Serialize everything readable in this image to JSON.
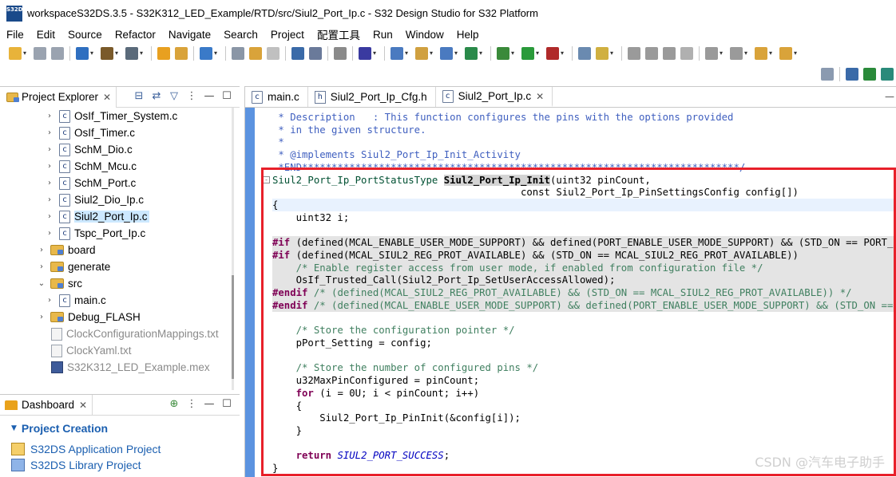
{
  "window": {
    "title": "workspaceS32DS.3.5 - S32K312_LED_Example/RTD/src/Siul2_Port_Ip.c - S32 Design Studio for S32 Platform",
    "logo_text": "S32DS"
  },
  "menu": [
    "File",
    "Edit",
    "Source",
    "Refactor",
    "Navigate",
    "Search",
    "Project",
    "配置工具",
    "Run",
    "Window",
    "Help"
  ],
  "project_explorer": {
    "title": "Project Explorer",
    "close_glyph": "✕",
    "tree": [
      {
        "label": "OsIf_Timer_System.c",
        "kind": "c",
        "indent": 3,
        "expander": "›"
      },
      {
        "label": "OsIf_Timer.c",
        "kind": "c",
        "indent": 3,
        "expander": "›"
      },
      {
        "label": "SchM_Dio.c",
        "kind": "c",
        "indent": 3,
        "expander": "›"
      },
      {
        "label": "SchM_Mcu.c",
        "kind": "c",
        "indent": 3,
        "expander": "›"
      },
      {
        "label": "SchM_Port.c",
        "kind": "c",
        "indent": 3,
        "expander": "›"
      },
      {
        "label": "Siul2_Dio_Ip.c",
        "kind": "c",
        "indent": 3,
        "expander": "›"
      },
      {
        "label": "Siul2_Port_Ip.c",
        "kind": "c",
        "indent": 3,
        "expander": "›",
        "selected": true
      },
      {
        "label": "Tspc_Port_Ip.c",
        "kind": "c",
        "indent": 3,
        "expander": "›"
      },
      {
        "label": "board",
        "kind": "folder",
        "indent": 2,
        "expander": "›"
      },
      {
        "label": "generate",
        "kind": "folder",
        "indent": 2,
        "expander": "›"
      },
      {
        "label": "src",
        "kind": "folder",
        "indent": 2,
        "expander": "⌄"
      },
      {
        "label": "main.c",
        "kind": "c",
        "indent": 3,
        "expander": "›"
      },
      {
        "label": "Debug_FLASH",
        "kind": "folder",
        "indent": 2,
        "expander": "›"
      },
      {
        "label": "ClockConfigurationMappings.txt",
        "kind": "txt",
        "indent": 2,
        "expander": "",
        "dimmed": true
      },
      {
        "label": "ClockYaml.txt",
        "kind": "txt",
        "indent": 2,
        "expander": "",
        "dimmed": true
      },
      {
        "label": "S32K312_LED_Example.mex",
        "kind": "mex",
        "indent": 2,
        "expander": "",
        "dimmed": true
      }
    ]
  },
  "dashboard": {
    "title": "Dashboard",
    "close_glyph": "✕",
    "section": "Project Creation",
    "links": [
      "S32DS Application Project",
      "S32DS Library Project"
    ]
  },
  "editor": {
    "tabs": [
      {
        "label": "main.c",
        "icon": "c"
      },
      {
        "label": "Siul2_Port_Ip_Cfg.h",
        "icon": "h"
      },
      {
        "label": "Siul2_Port_Ip.c",
        "icon": "c",
        "active": true,
        "close": "✕"
      }
    ],
    "lines": [
      {
        "spans": [
          {
            "t": " * Description   : This function configures the pins with the options provided",
            "c": "c-doc"
          }
        ]
      },
      {
        "spans": [
          {
            "t": " * in the given structure.",
            "c": "c-doc"
          }
        ]
      },
      {
        "spans": [
          {
            "t": " *",
            "c": "c-doc"
          }
        ]
      },
      {
        "spans": [
          {
            "t": " * @implements Siul2_Port_Ip_Init_Activity",
            "c": "c-doc"
          }
        ]
      },
      {
        "spans": [
          {
            "t": " *END**************************************************************************/",
            "c": "c-doc"
          }
        ]
      },
      {
        "fold": "⊖",
        "spans": [
          {
            "t": "Siul2_Port_Ip_PortStatusType ",
            "c": "c-type"
          },
          {
            "t": "Siul2_Port_Ip_Init",
            "c": "c-fn-sel"
          },
          {
            "t": "(uint32 pinCount,",
            "c": "c-plain"
          }
        ]
      },
      {
        "spans": [
          {
            "t": "                                          const Siul2_Port_Ip_PinSettingsConfig config[])",
            "c": "c-plain"
          }
        ]
      },
      {
        "bg": "hl-blue",
        "spans": [
          {
            "t": "{",
            "c": "c-plain"
          }
        ]
      },
      {
        "spans": [
          {
            "t": "    uint32 i;",
            "c": "c-plain"
          }
        ]
      },
      {
        "spans": [
          {
            "t": "",
            "c": "c-plain"
          }
        ]
      },
      {
        "bg": "hl",
        "spans": [
          {
            "t": "#if",
            "c": "c-kw"
          },
          {
            "t": " (defined(MCAL_ENABLE_USER_MODE_SUPPORT) && defined(PORT_ENABLE_USER_MODE_SUPPORT) && (STD_ON == PORT_ENABLE_USER_MODE_SUPPORT))",
            "c": "c-plain"
          }
        ]
      },
      {
        "bg": "hl",
        "spans": [
          {
            "t": "#if",
            "c": "c-kw"
          },
          {
            "t": " (defined(MCAL_SIUL2_REG_PROT_AVAILABLE) && (STD_ON == MCAL_SIUL2_REG_PROT_AVAILABLE))",
            "c": "c-plain"
          }
        ]
      },
      {
        "bg": "hl",
        "spans": [
          {
            "t": "    /* Enable register access from user mode, if enabled from configuration file */",
            "c": "c-comment"
          }
        ]
      },
      {
        "bg": "hl",
        "spans": [
          {
            "t": "    OsIf_Trusted_Call(Siul2_Port_Ip_SetUserAccessAllowed);",
            "c": "c-plain"
          }
        ]
      },
      {
        "bg": "hl",
        "spans": [
          {
            "t": "#endif",
            "c": "c-kw"
          },
          {
            "t": " /* (defined(MCAL_SIUL2_REG_PROT_AVAILABLE) && (STD_ON == MCAL_SIUL2_REG_PROT_AVAILABLE)) */",
            "c": "c-comment"
          }
        ]
      },
      {
        "bg": "hl",
        "spans": [
          {
            "t": "#endif",
            "c": "c-kw"
          },
          {
            "t": " /* (defined(MCAL_ENABLE_USER_MODE_SUPPORT) && defined(PORT_ENABLE_USER_MODE_SUPPORT) && (STD_ON == PORT_ENABLE_USER_MODE_SUPPORT)) */",
            "c": "c-comment"
          }
        ]
      },
      {
        "spans": [
          {
            "t": "",
            "c": "c-plain"
          }
        ]
      },
      {
        "spans": [
          {
            "t": "    /* Store the configuration pointer */",
            "c": "c-comment"
          }
        ]
      },
      {
        "spans": [
          {
            "t": "    pPort_Setting = config;",
            "c": "c-plain"
          }
        ]
      },
      {
        "spans": [
          {
            "t": "",
            "c": "c-plain"
          }
        ]
      },
      {
        "spans": [
          {
            "t": "    /* Store the number of configured pins */",
            "c": "c-comment"
          }
        ]
      },
      {
        "spans": [
          {
            "t": "    u32MaxPinConfigured = pinCount;",
            "c": "c-plain"
          }
        ]
      },
      {
        "spans": [
          {
            "t": "    ",
            "c": "c-plain"
          },
          {
            "t": "for",
            "c": "c-kw"
          },
          {
            "t": " (i = 0U; i < pinCount; i++)",
            "c": "c-plain"
          }
        ]
      },
      {
        "spans": [
          {
            "t": "    {",
            "c": "c-plain"
          }
        ]
      },
      {
        "spans": [
          {
            "t": "        Siul2_Port_Ip_PinInit(&config[i]);",
            "c": "c-plain"
          }
        ]
      },
      {
        "spans": [
          {
            "t": "    }",
            "c": "c-plain"
          }
        ]
      },
      {
        "spans": [
          {
            "t": "",
            "c": "c-plain"
          }
        ]
      },
      {
        "spans": [
          {
            "t": "    ",
            "c": "c-plain"
          },
          {
            "t": "return",
            "c": "c-kw"
          },
          {
            "t": " ",
            "c": "c-plain"
          },
          {
            "t": "SIUL2_PORT_SUCCESS",
            "c": "c-macro"
          },
          {
            "t": ";",
            "c": "c-plain"
          }
        ]
      },
      {
        "spans": [
          {
            "t": "}",
            "c": "c-plain"
          }
        ]
      }
    ]
  },
  "watermark": "CSDN @汽车电子助手",
  "colors": {
    "highlight_box": "#e8202a",
    "gutter": "#5b93e0",
    "link": "#1b5fb0"
  }
}
